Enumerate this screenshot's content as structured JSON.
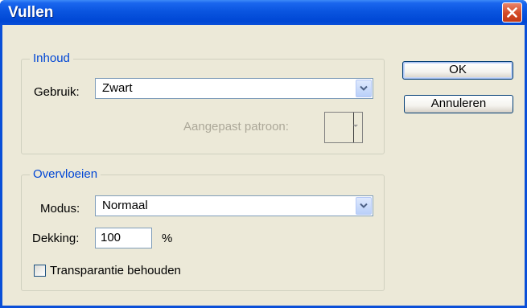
{
  "window": {
    "title": "Vullen"
  },
  "content_group": {
    "legend": "Inhoud",
    "use_label": "Gebruik:",
    "use_value": "Zwart",
    "custom_pattern_label": "Aangepast patroon:"
  },
  "blend_group": {
    "legend": "Overvloeien",
    "mode_label": "Modus:",
    "mode_value": "Normaal",
    "opacity_label": "Dekking:",
    "opacity_value": "100",
    "opacity_unit": "%",
    "preserve_transparency_label": "Transparantie behouden",
    "preserve_transparency_checked": false
  },
  "buttons": {
    "ok": "OK",
    "cancel": "Annuleren"
  }
}
